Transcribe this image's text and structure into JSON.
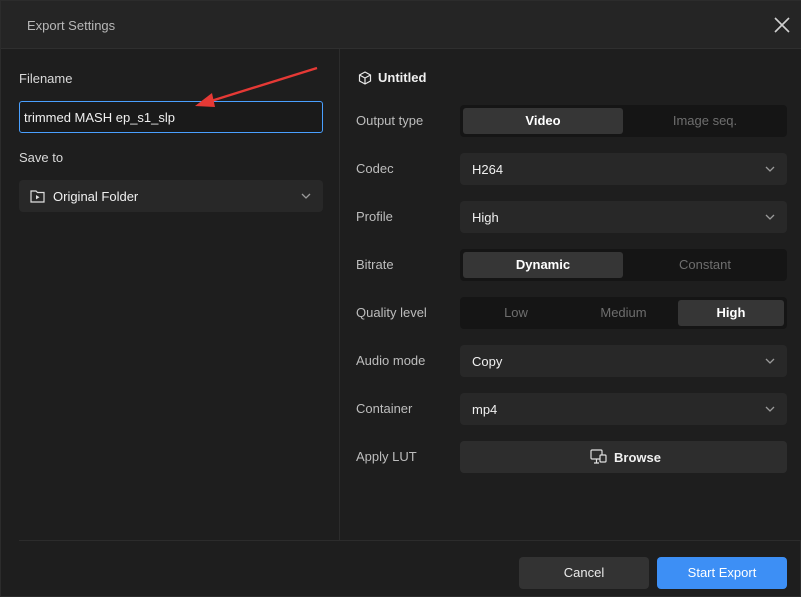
{
  "window": {
    "title": "Export Settings"
  },
  "left": {
    "filename_label": "Filename",
    "filename_value": "trimmed MASH ep_s1_slp",
    "save_to_label": "Save to",
    "save_to_value": "Original Folder"
  },
  "right": {
    "section_title": "Untitled",
    "output_type": {
      "label": "Output type",
      "options": [
        "Video",
        "Image seq."
      ],
      "selected": "Video"
    },
    "codec": {
      "label": "Codec",
      "value": "H264"
    },
    "profile": {
      "label": "Profile",
      "value": "High"
    },
    "bitrate": {
      "label": "Bitrate",
      "options": [
        "Dynamic",
        "Constant"
      ],
      "selected": "Dynamic"
    },
    "quality": {
      "label": "Quality level",
      "options": [
        "Low",
        "Medium",
        "High"
      ],
      "selected": "High"
    },
    "audio_mode": {
      "label": "Audio mode",
      "value": "Copy"
    },
    "container": {
      "label": "Container",
      "value": "mp4"
    },
    "apply_lut": {
      "label": "Apply LUT",
      "button": "Browse"
    }
  },
  "footer": {
    "cancel": "Cancel",
    "start": "Start Export"
  },
  "icons": [
    "close-icon",
    "folder-icon",
    "chevron-down-icon",
    "cube-icon",
    "browse-icon",
    "annotation-arrow"
  ],
  "colors": {
    "accent": "#3d8ff5",
    "input_border": "#4aa0ff",
    "annotation": "#e53935"
  }
}
